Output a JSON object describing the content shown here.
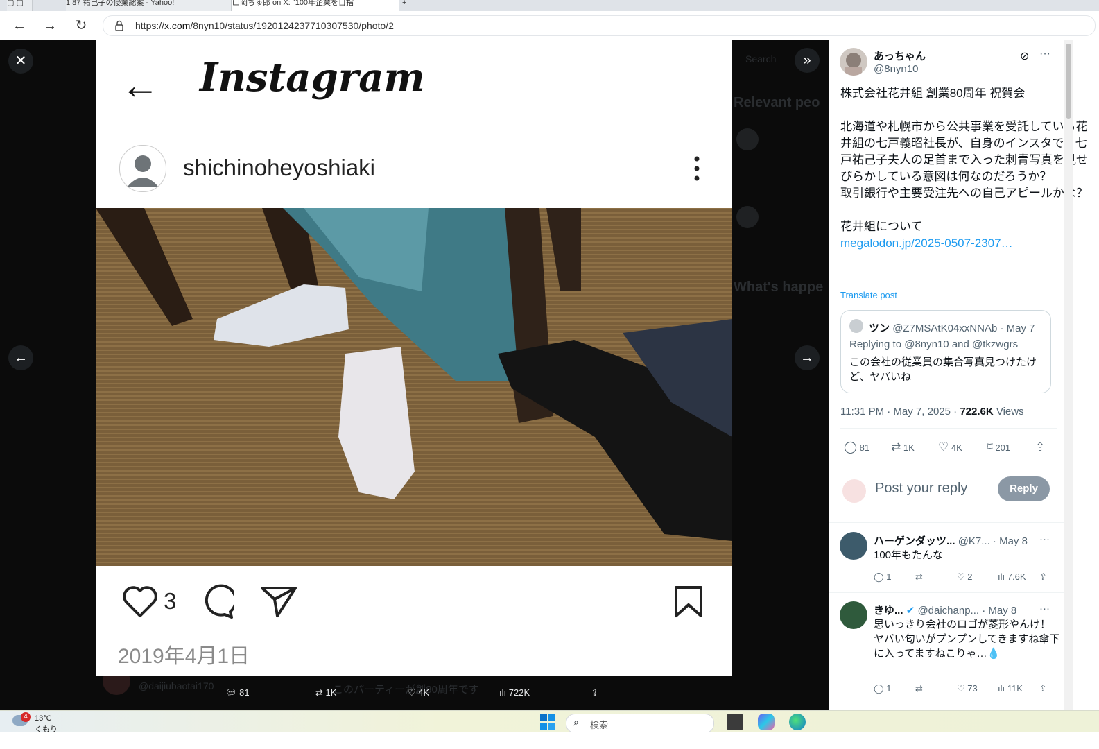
{
  "browser": {
    "tabs": [
      {
        "label": "1 87 祐己子の侵業総案 - Yahoo!"
      },
      {
        "label": "山岡ちゅ郎 on X: \"100年企業を目指"
      }
    ],
    "url_prefix": "https://",
    "url_domain": "x.com",
    "url_path": "/8nyn10/status/1920124237710307530/photo/2"
  },
  "viewer": {
    "close_icon": "close-icon",
    "prev_icon": "arrow-left-icon",
    "next_icon": "arrow-right-icon",
    "collapse_icon": "chevron-double-right-icon",
    "bottom_bar": {
      "replies": "81",
      "reposts": "1K",
      "likes": "4K",
      "views": "722K"
    },
    "background": {
      "search_placeholder": "Search",
      "relevant": "Relevant peo",
      "whats_happening": "What's happe",
      "bottom_text": "このパーティーが創80周年です",
      "bottom_handle": "@daijiubaotai170"
    }
  },
  "instagram": {
    "logo": "Instagram",
    "username": "shichinoheyoshiaki",
    "likes": "3",
    "date": "2019年4月1日"
  },
  "tweet": {
    "name": "あっちゃん",
    "handle": "@8nyn10",
    "body": "株式会社花井組 創業80周年 祝賀会\n\n北海道や札幌市から公共事業を受託している花井組の七戸義昭社長が、自身のインスタで、七戸祐己子夫人の足首まで入った刺青写真を見せびらかしている意図は何なのだろうか？\n取引銀行や主要受注先への自己アピールかな？\n\n花井組について",
    "link": "megalodon.jp/2025-0507-2307…",
    "translate": "Translate post",
    "quote": {
      "name": "ツン",
      "handle": "@Z7MSAtK04xxNNAb · May 7",
      "replying": "Replying to @8nyn10 and @tkzwgrs",
      "text": "この会社の従業員の集合写真見つけたけど、ヤバいね"
    },
    "time": "11:31 PM · May 7, 2025 · ",
    "views": "722.6K",
    "views_label": " Views",
    "stats": {
      "replies": "81",
      "reposts": "1K",
      "likes": "4K",
      "bookmarks": "201"
    },
    "reply_placeholder": "Post your reply",
    "reply_button": "Reply"
  },
  "replies": [
    {
      "name": "ハーゲンダッツ...",
      "handle": "@K7... · May 8",
      "text": "100年もたんな",
      "replies": "1",
      "likes": "2",
      "views": "7.6K"
    },
    {
      "name": "きゆ...",
      "handle": "@daichanp... · May 8",
      "text": "思いっきり会社のロゴが菱形やんけ！\nヤバい匂いがプンプンしてきますね傘下に入ってますねこりゃ…💧",
      "replies": "1",
      "likes": "73",
      "views": "11K"
    }
  ],
  "taskbar": {
    "temp": "13°C",
    "weather_sub": "くもり",
    "badge": "4",
    "search": "検索"
  },
  "colors": {
    "accent": "#1d9bf0",
    "viewer_bg": "#0b0b0b",
    "reply_button": "#8b98a5"
  }
}
